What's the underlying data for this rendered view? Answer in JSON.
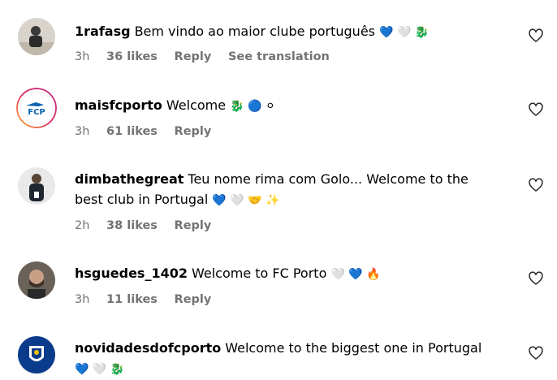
{
  "colors": {
    "meta_gray": "#737373",
    "blue_heart": "#1a5fb4",
    "brand_blue": "#0a64b0"
  },
  "comments": [
    {
      "username": "1rafasg",
      "text": "Bem vindo ao maior clube português",
      "emojis": "💙 🤍 🐉",
      "time": "3h",
      "likes": "36 likes",
      "reply": "Reply",
      "translate": "See translation"
    },
    {
      "username": "maisfcporto",
      "text": "Welcome",
      "emojis": "🐉 🔵 ⚪",
      "time": "3h",
      "likes": "61 likes",
      "reply": "Reply"
    },
    {
      "username": "dimbathegreat",
      "text": "Teu nome rima com Golo... Welcome to the best club in Portugal",
      "emojis": "💙 🤍 🤝 ✨",
      "time": "2h",
      "likes": "38 likes",
      "reply": "Reply"
    },
    {
      "username": "hsguedes_1402",
      "text": "Welcome to FC Porto",
      "emojis": "🤍 💙 🔥",
      "time": "3h",
      "likes": "11 likes",
      "reply": "Reply"
    },
    {
      "username": "novidadesdofcporto",
      "text": "Welcome to the biggest one in Portugal",
      "emojis": "💙 🤍 🐉"
    }
  ]
}
